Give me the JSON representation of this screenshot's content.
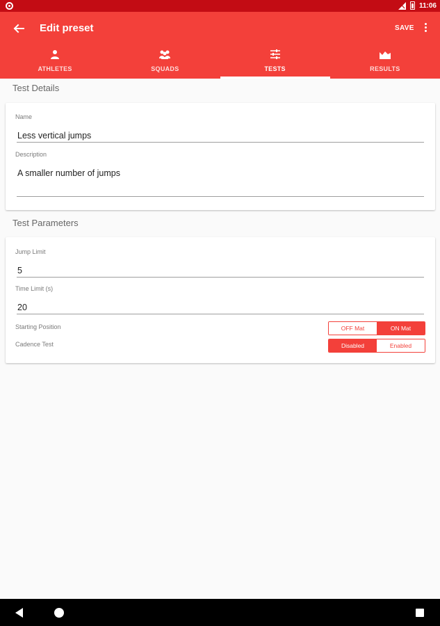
{
  "status_bar": {
    "time": "11:06"
  },
  "app_bar": {
    "title": "Edit preset",
    "save_label": "SAVE",
    "back_icon": "arrow-back-icon",
    "overflow_icon": "more-vert-icon"
  },
  "tabs": [
    {
      "label": "ATHLETES",
      "icon": "person-icon",
      "active": false
    },
    {
      "label": "SQUADS",
      "icon": "group-icon",
      "active": false
    },
    {
      "label": "TESTS",
      "icon": "tune-icon",
      "active": true
    },
    {
      "label": "RESULTS",
      "icon": "area-chart-icon",
      "active": false
    }
  ],
  "test_details": {
    "heading": "Test Details",
    "name_label": "Name",
    "name_value": "Less vertical jumps",
    "description_label": "Description",
    "description_value": "A smaller number of jumps"
  },
  "test_parameters": {
    "heading": "Test Parameters",
    "jump_limit_label": "Jump Limit",
    "jump_limit_value": "5",
    "time_limit_label": "Time Limit (s)",
    "time_limit_value": "20",
    "starting_position": {
      "label": "Starting Position",
      "options": [
        "OFF Mat",
        "ON Mat"
      ],
      "selected": "ON Mat"
    },
    "cadence_test": {
      "label": "Cadence Test",
      "options": [
        "Disabled",
        "Enabled"
      ],
      "selected": "Disabled"
    }
  },
  "colors": {
    "accent": "#f3403a",
    "status_bar": "#c30c14",
    "background": "#fafafa"
  }
}
